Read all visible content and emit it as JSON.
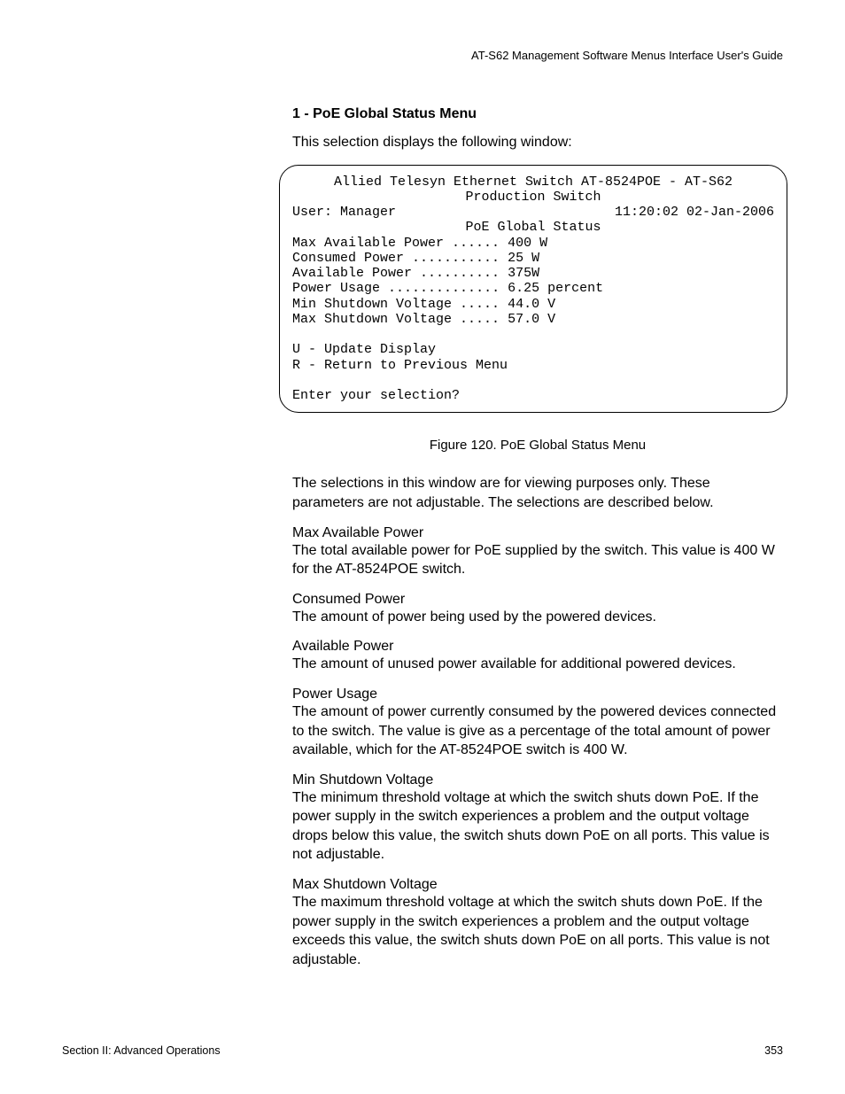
{
  "runningHeader": "AT-S62 Management Software Menus Interface User's Guide",
  "sectionHeading": "1 - PoE Global Status Menu",
  "intro": "This selection displays the following window:",
  "terminal": {
    "title1": "Allied Telesyn Ethernet Switch AT-8524POE - AT-S62",
    "title2": "Production Switch",
    "userLabel": "User: Manager",
    "datetime": "11:20:02 02-Jan-2006",
    "subtitle": "PoE Global Status",
    "rows": [
      {
        "label": "Max Available Power",
        "dots": "......",
        "value": "400 W"
      },
      {
        "label": "Consumed Power",
        "dots": "...........",
        "value": "25 W"
      },
      {
        "label": "Available Power",
        "dots": "..........",
        "value": "375W"
      },
      {
        "label": "Power Usage",
        "dots": "..............",
        "value": "6.25 percent"
      },
      {
        "label": "Min Shutdown Voltage",
        "dots": ".....",
        "value": "44.0 V"
      },
      {
        "label": "Max Shutdown Voltage",
        "dots": ".....",
        "value": "57.0 V"
      }
    ],
    "option1": "U - Update Display",
    "option2": "R - Return to Previous Menu",
    "prompt": "Enter your selection?"
  },
  "figureCaption": "Figure 120. PoE Global Status Menu",
  "note": "The selections in this window are for viewing purposes only. These parameters are not adjustable. The selections are described below.",
  "defs": [
    {
      "term": "Max Available Power",
      "desc": "The total available power for PoE supplied by the switch. This value is 400 W for the AT-8524POE switch."
    },
    {
      "term": "Consumed Power",
      "desc": "The amount of power being used by the powered devices."
    },
    {
      "term": "Available Power",
      "desc": "The amount of unused power available for additional powered devices."
    },
    {
      "term": "Power Usage",
      "desc": "The amount of power currently consumed by the powered devices connected to the switch. The value is give as a percentage of the total amount of power available, which for the AT-8524POE switch is 400 W."
    },
    {
      "term": "Min Shutdown Voltage",
      "desc": "The minimum threshold voltage at which the switch shuts down PoE. If the power supply in the switch experiences a problem and the output voltage drops below this value, the switch shuts down PoE on all ports. This value is not adjustable."
    },
    {
      "term": "Max Shutdown Voltage",
      "desc": "The maximum threshold voltage at which the switch shuts down PoE. If the power supply in the switch experiences a problem and the output voltage exceeds this value, the switch shuts down PoE on all ports. This value is not adjustable."
    }
  ],
  "footerLeft": "Section II: Advanced Operations",
  "footerRight": "353"
}
